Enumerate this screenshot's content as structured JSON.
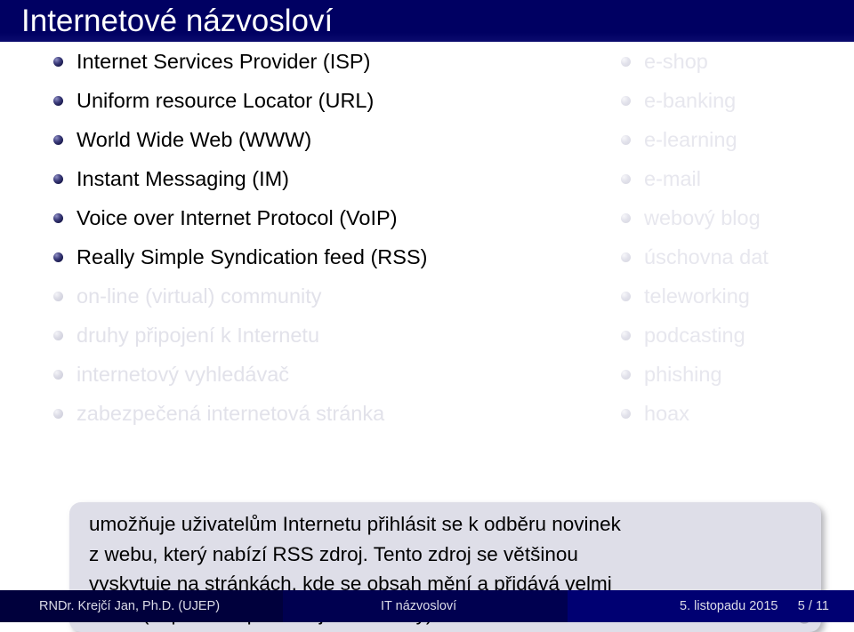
{
  "slide": {
    "title": "Internetové názvosloví",
    "accent_navy": "#000062",
    "callout_bg": "#dedee8",
    "bullet_active_color": "#1c1c50",
    "bullet_dim_color": "#d5d5e0"
  },
  "left_column": {
    "items": [
      {
        "label": "Internet Services Provider (ISP)",
        "state": "active"
      },
      {
        "label": "Uniform resource Locator (URL)",
        "state": "active"
      },
      {
        "label": "World Wide Web (WWW)",
        "state": "active"
      },
      {
        "label": "Instant Messaging (IM)",
        "state": "active"
      },
      {
        "label": "Voice over Internet Protocol (VoIP)",
        "state": "active"
      },
      {
        "label": "Really Simple Syndication feed (RSS)",
        "state": "active"
      },
      {
        "label": "on-line (virtual) community",
        "state": "dim"
      },
      {
        "label": "druhy připojení k Internetu",
        "state": "dim"
      },
      {
        "label": "internetový vyhledávač",
        "state": "dim"
      },
      {
        "label": "zabezpečená internetová stránka",
        "state": "dim"
      }
    ]
  },
  "right_column": {
    "items": [
      {
        "label": "e-shop",
        "state": "faint"
      },
      {
        "label": "e-banking",
        "state": "faint"
      },
      {
        "label": "e-learning",
        "state": "faint"
      },
      {
        "label": "e-mail",
        "state": "faint"
      },
      {
        "label": "webový blog",
        "state": "faint"
      },
      {
        "label": "úschovna dat",
        "state": "faint"
      },
      {
        "label": "teleworking",
        "state": "faint"
      },
      {
        "label": "podcasting",
        "state": "faint"
      },
      {
        "label": "phishing",
        "state": "faint"
      },
      {
        "label": "hoax",
        "state": "faint"
      }
    ]
  },
  "callout": {
    "lines": [
      "umožňuje uživatelům Internetu přihlásit se k odběru novinek",
      "z webu, který nabízí RSS zdroj. Tento zdroj se většinou",
      "vyskytuje na stránkách, kde se obsah mění a přidává velmi",
      "často (například zpravodajské servery)."
    ],
    "nav_icon": "circular-arrow-icon"
  },
  "footer": {
    "author": "RNDr. Krejčí Jan, Ph.D.  (UJEP)",
    "short_title": "IT názvosloví",
    "date": "5. listopadu 2015",
    "page": "5 / 11"
  }
}
